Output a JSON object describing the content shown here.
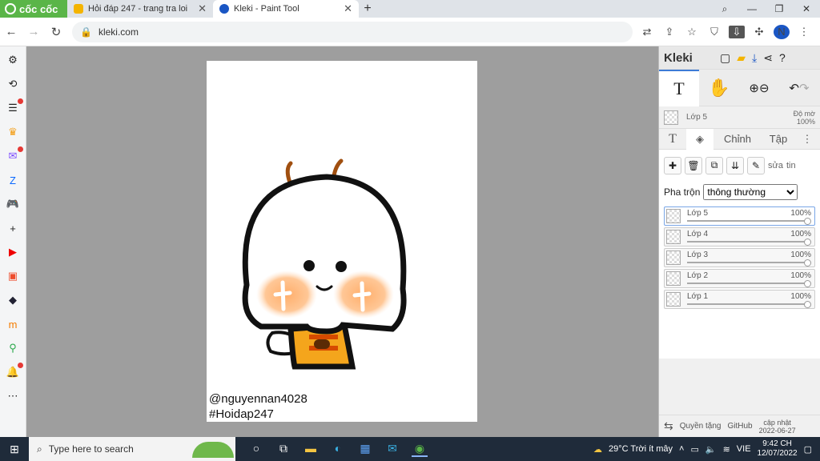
{
  "browser": {
    "brand": "cốc cốc",
    "tabs": [
      {
        "title": "Hỏi đáp 247 - trang tra loi",
        "active": false
      },
      {
        "title": "Kleki - Paint Tool",
        "active": true
      }
    ],
    "url": "kleki.com",
    "profile_initial": "N"
  },
  "canvas": {
    "watermark_line1": "@nguyennan4028",
    "watermark_line2": " #Hoidap247"
  },
  "kleki": {
    "brand": "Kleki",
    "current_layer": "Lớp 5",
    "opacity_label": "Độ mờ",
    "opacity_value": "100%",
    "tabs": [
      "Chỉnh",
      "Tập"
    ],
    "edit_label": "sửa",
    "info_label": "tin",
    "blend_label": "Pha trộn",
    "blend_value": "thông thường",
    "layers": [
      {
        "name": "Lớp 5",
        "opacity": "100%",
        "current": true
      },
      {
        "name": "Lớp 4",
        "opacity": "100%",
        "current": false
      },
      {
        "name": "Lớp 3",
        "opacity": "100%",
        "current": false
      },
      {
        "name": "Lớp 2",
        "opacity": "100%",
        "current": false
      },
      {
        "name": "Lớp 1",
        "opacity": "100%",
        "current": false
      }
    ],
    "footer": {
      "settings": "Quyền tặng",
      "github": "GitHub",
      "update_label": "cập nhật",
      "update_date": "2022-06-27"
    }
  },
  "taskbar": {
    "search_placeholder": "Type here to search",
    "weather": "29°C  Trời ít mây",
    "lang": "VIE",
    "time": "9:42 CH",
    "date": "12/07/2022"
  }
}
